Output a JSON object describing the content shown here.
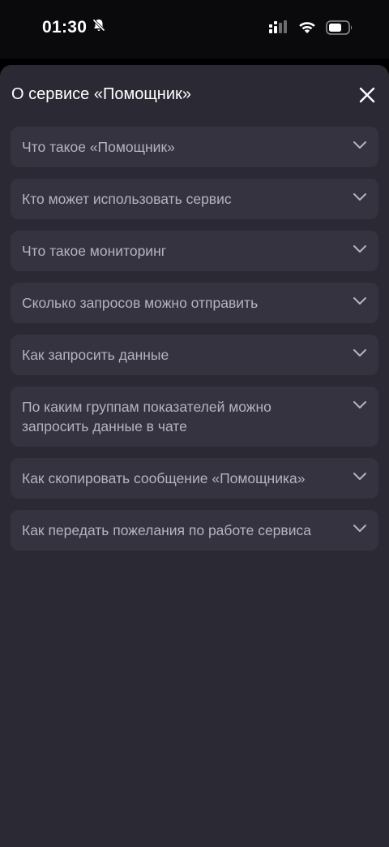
{
  "status_bar": {
    "time": "01:30",
    "icons": [
      "bell-slash-icon",
      "cellular-signal-icon",
      "wifi-icon",
      "battery-icon"
    ]
  },
  "sheet": {
    "title": "О сервисе «Помощник»",
    "close_icon": "close-icon",
    "faq": [
      {
        "question": "Что такое «Помощник»"
      },
      {
        "question": "Кто может использовать сервис"
      },
      {
        "question": "Что такое мониторинг"
      },
      {
        "question": "Сколько запросов можно отправить"
      },
      {
        "question": "Как запросить данные"
      },
      {
        "question": "По каким группам показателей можно запросить данные в чате"
      },
      {
        "question": "Как скопировать сообщение «Помощника»"
      },
      {
        "question": "Как передать пожелания по работе сервиса"
      }
    ]
  },
  "colors": {
    "sheet_background": "#2b2934",
    "item_background": "#353340",
    "question_text": "#b5b3bd",
    "title_text": "#ffffff"
  }
}
